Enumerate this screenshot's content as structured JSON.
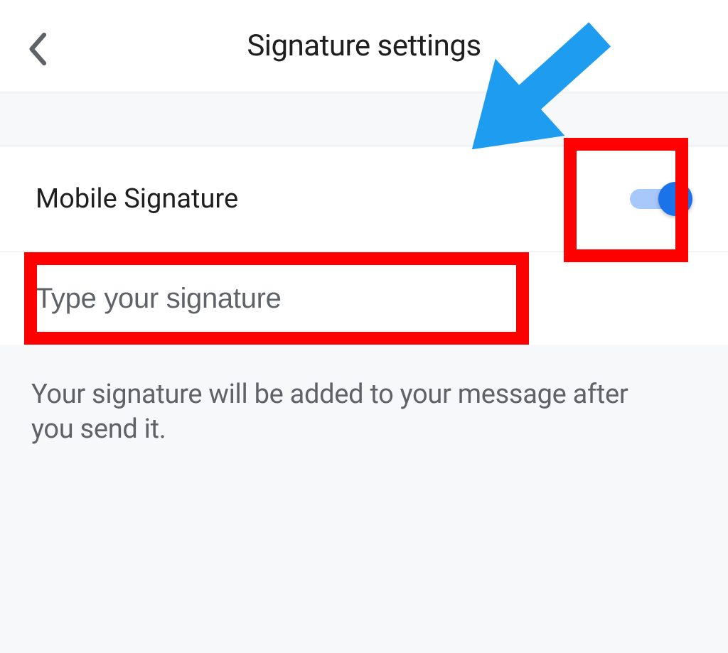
{
  "header": {
    "title": "Signature settings"
  },
  "setting": {
    "label": "Mobile Signature",
    "toggle_on": true
  },
  "input": {
    "placeholder": "Type your signature",
    "value": ""
  },
  "description": {
    "text": "Your signature will be added to your message after you send it."
  },
  "colors": {
    "accent": "#1a73e8",
    "accent_light": "#a8c7fa",
    "annotation_red": "#ff0000",
    "annotation_blue": "#1e9cf0"
  }
}
